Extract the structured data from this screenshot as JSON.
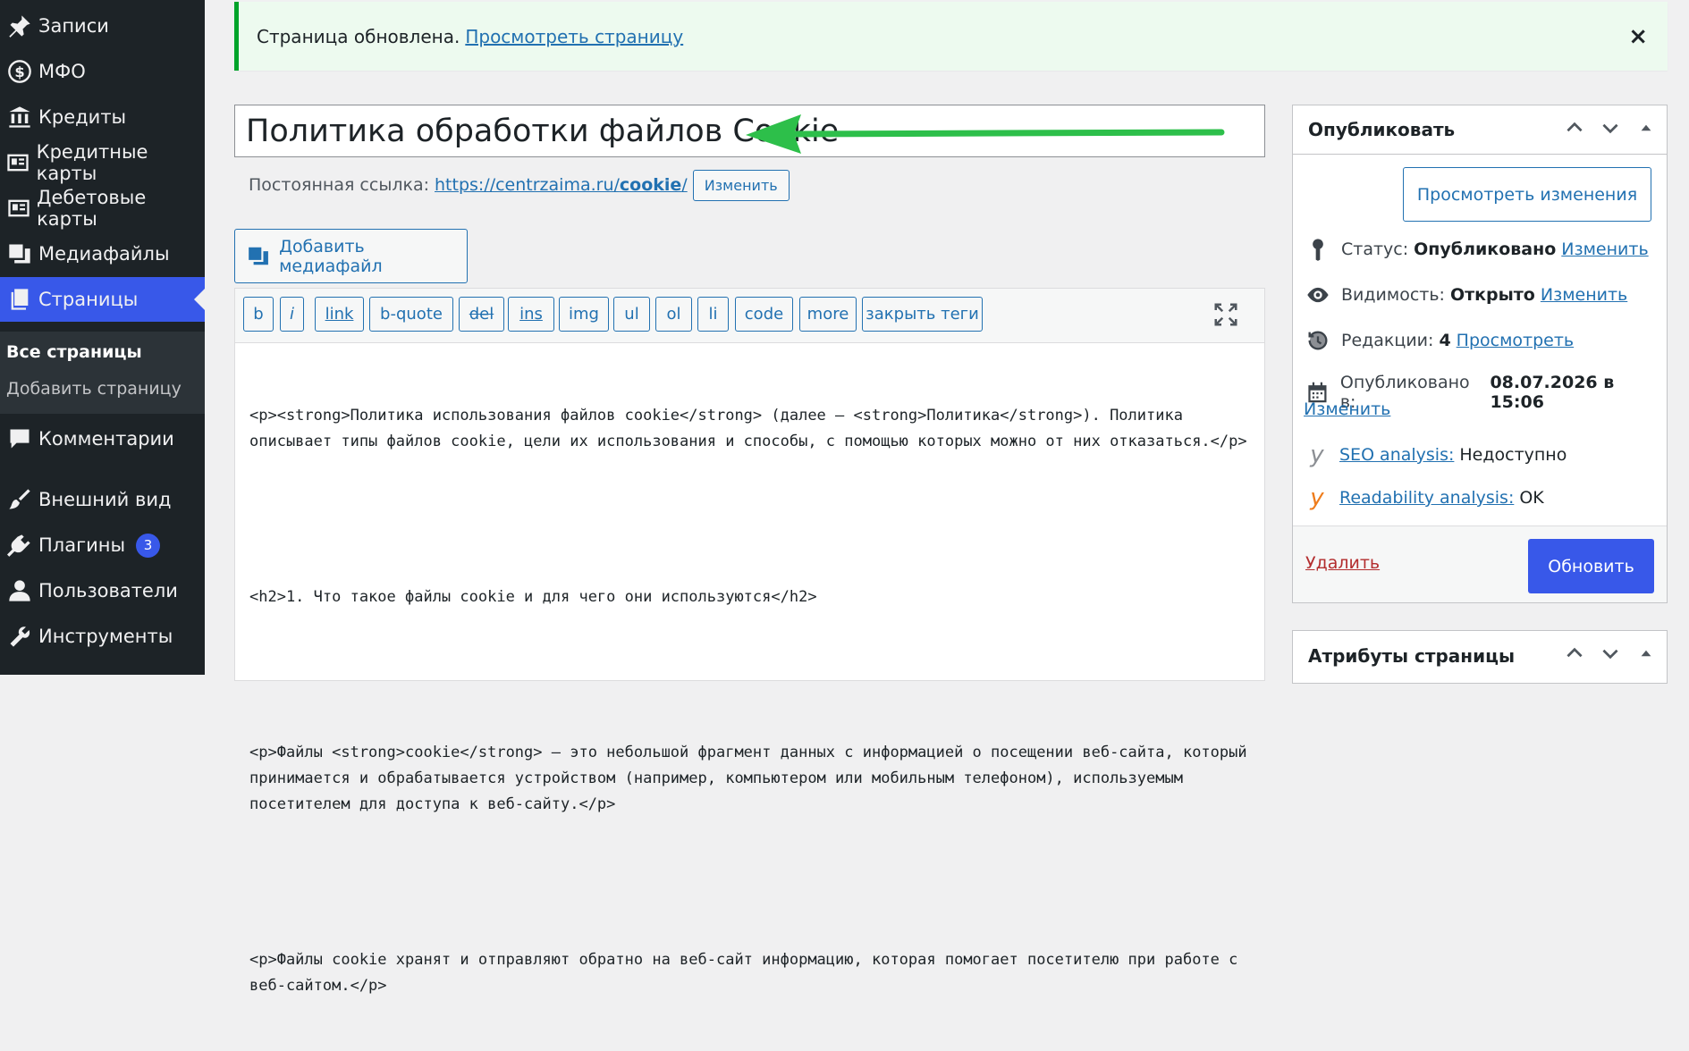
{
  "sidebar": {
    "items": [
      {
        "label": "Записи",
        "icon": "pin-icon"
      },
      {
        "label": "МФО",
        "icon": "dollar-icon"
      },
      {
        "label": "Кредиты",
        "icon": "bank-icon"
      },
      {
        "label": "Кредитные карты",
        "icon": "id-card-icon"
      },
      {
        "label": "Дебетовые карты",
        "icon": "id-card-icon"
      },
      {
        "label": "Медиафайлы",
        "icon": "media-icon"
      },
      {
        "label": "Страницы",
        "icon": "pages-icon"
      },
      {
        "label": "Комментарии",
        "icon": "comment-icon"
      },
      {
        "label": "Внешний вид",
        "icon": "brush-icon"
      },
      {
        "label": "Плагины",
        "icon": "plugin-icon",
        "badge": "3"
      },
      {
        "label": "Пользователи",
        "icon": "user-icon"
      },
      {
        "label": "Инструменты",
        "icon": "tools-icon"
      }
    ],
    "submenu": {
      "all_pages": "Все страницы",
      "add_page": "Добавить страницу"
    }
  },
  "notice": {
    "text": "Страница обновлена.",
    "link": "Просмотреть страницу",
    "close": "×"
  },
  "editor": {
    "title": "Политика обработки файлов Cookie",
    "permalink_label": "Постоянная ссылка:",
    "permalink_base": "https://centrzaima.ru/",
    "permalink_slug": "cookie",
    "permalink_trail": "/",
    "permalink_edit": "Изменить",
    "add_media": "Добавить медиафайл",
    "quicktags": [
      "b",
      "i",
      "link",
      "b-quote",
      "del",
      "ins",
      "img",
      "ul",
      "ol",
      "li",
      "code",
      "more",
      "закрыть теги"
    ],
    "content": [
      "<p><strong>Политика использования файлов cookie</strong> (далее – <strong>Политика</strong>). Политика описывает типы файлов cookie, цели их использования и способы, с помощью которых можно от них отказаться.</p>",
      "<h2>1. Что такое файлы cookie и для чего они используются</h2>",
      "<p>Файлы <strong>cookie</strong> – это небольшой фрагмент данных с информацией о посещении веб-сайта, который принимается и обрабатывается устройством (например, компьютером или мобильным телефоном), используемым посетителем для доступа к веб-сайту.</p>",
      "<p>Файлы cookie хранят и отправляют обратно на веб-сайт информацию, которая помогает посетителю при работе с веб-сайтом.</p>"
    ]
  },
  "publish": {
    "title": "Опубликовать",
    "preview": "Просмотреть изменения",
    "status_label": "Статус:",
    "status_value": "Опубликовано",
    "status_edit": "Изменить",
    "visibility_label": "Видимость:",
    "visibility_value": "Открыто",
    "visibility_edit": "Изменить",
    "revisions_label": "Редакции:",
    "revisions_value": "4",
    "revisions_link": "Просмотреть",
    "published_label": "Опубликовано в:",
    "published_value": "08.07.2026 в 15:06",
    "published_edit": "Изменить",
    "seo_link": "SEO analysis:",
    "seo_value": "Недоступно",
    "readability_link": "Readability analysis:",
    "readability_value": "OK",
    "delete": "Удалить",
    "update": "Обновить"
  },
  "page_attributes": {
    "title": "Атрибуты страницы"
  },
  "colors": {
    "sidebar_bg": "#1d2327",
    "accent": "#3858e9",
    "link": "#2271b1",
    "notice_border": "#00a32a",
    "arrow": "#2dbf4a",
    "delete": "#b32d2e"
  }
}
